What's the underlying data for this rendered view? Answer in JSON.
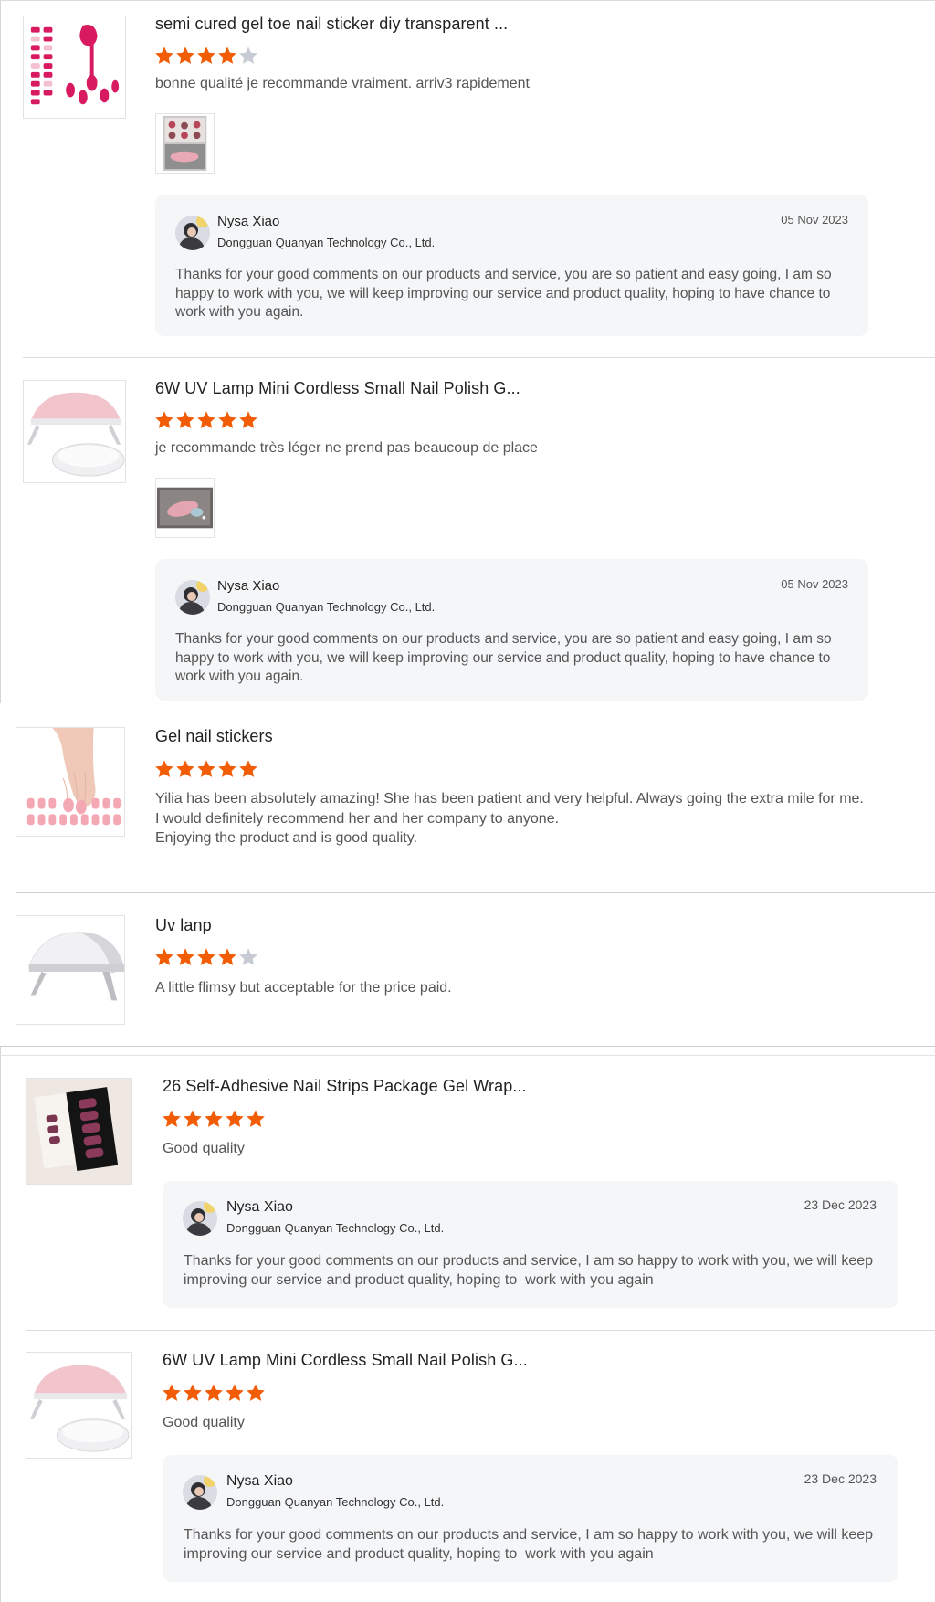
{
  "colors": {
    "star_filled": "#f25c05",
    "star_empty": "#c7cbd4",
    "reply_bg": "#f5f6f8"
  },
  "reviews": [
    {
      "title": "semi cured gel toe nail sticker diy transparent ...",
      "rating": 4,
      "comment": "bonne qualité je recommande vraiment. arriv3 rapidement",
      "has_photo": true,
      "reply": {
        "name": "Nysa Xiao",
        "company": "Dongguan Quanyan Technology Co., Ltd.",
        "date": "05 Nov 2023",
        "text": "Thanks for your good comments on our products and service, you are so patient and easy going, I am so happy to work with you, we will keep improving our service and product quality, hoping to have chance to work with you again."
      }
    },
    {
      "title": "6W UV Lamp Mini Cordless Small Nail Polish G...",
      "rating": 5,
      "comment": "je recommande très léger ne prend pas beaucoup de place",
      "has_photo": true,
      "reply": {
        "name": "Nysa Xiao",
        "company": "Dongguan Quanyan Technology Co., Ltd.",
        "date": "05 Nov 2023",
        "text": "Thanks for your good comments on our products and service, you are so patient and easy going, I am so happy to work with you, we will keep improving our service and product quality, hoping to have chance to work with you again."
      }
    },
    {
      "title": "Gel nail stickers",
      "rating": 5,
      "comment": "Yilia has been absolutely amazing! She has been patient and very helpful. Always going the extra mile for me. I would definitely recommend her and her company to anyone.\nEnjoying the product and is good quality."
    },
    {
      "title": "Uv lanp",
      "rating": 4,
      "comment": "A little flimsy but acceptable for the price paid."
    },
    {
      "title": "26 Self-Adhesive Nail Strips Package Gel Wrap...",
      "rating": 5,
      "comment": "Good quality",
      "reply": {
        "name": "Nysa Xiao",
        "company": "Dongguan Quanyan Technology Co., Ltd.",
        "date": "23 Dec 2023",
        "text": "Thanks for your good comments on our products and service, I am so happy to work with you, we will keep improving our service and product quality, hoping to  work with you again"
      }
    },
    {
      "title": "6W UV Lamp Mini Cordless Small Nail Polish G...",
      "rating": 5,
      "comment": "Good quality",
      "reply": {
        "name": "Nysa Xiao",
        "company": "Dongguan Quanyan Technology Co., Ltd.",
        "date": "23 Dec 2023",
        "text": "Thanks for your good comments on our products and service, I am so happy to work with you, we will keep improving our service and product quality, hoping to  work with you again"
      }
    }
  ]
}
